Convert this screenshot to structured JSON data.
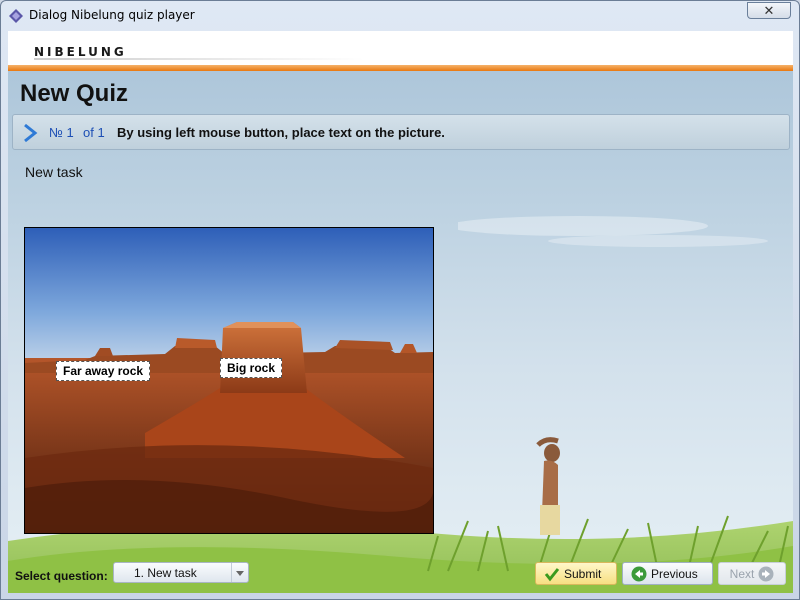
{
  "window": {
    "title": "Dialog Nibelung quiz player",
    "close_glyph": "✕"
  },
  "header": {
    "logo_text": "NIBELUNG"
  },
  "quiz": {
    "title": "New Quiz",
    "task_number": "№ 1",
    "task_of": "of 1",
    "instruction": "By using left mouse button, place text on the picture.",
    "task_name": "New task"
  },
  "picture": {
    "labels": [
      {
        "text": "Far away rock"
      },
      {
        "text": "Big rock"
      }
    ]
  },
  "footer": {
    "select_label": "Select question:",
    "select_value": "1. New task",
    "submit_label": "Submit",
    "previous_label": "Previous",
    "next_label": "Next"
  },
  "colors": {
    "accent_orange": "#e8780f",
    "task_blue": "#1d4fb5"
  },
  "icons": [
    "app-icon",
    "close-icon",
    "chevron-right-icon",
    "checkmark-icon",
    "back-arrow-icon",
    "forward-arrow-icon"
  ]
}
